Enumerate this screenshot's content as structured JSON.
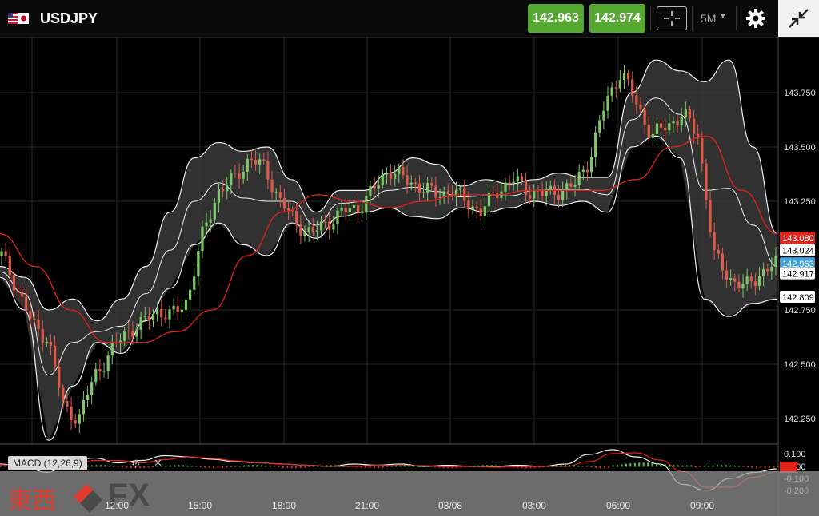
{
  "header": {
    "symbol": "USDJPY",
    "bid": "142.963",
    "ask": "142.974",
    "timeframe": "5M",
    "bid_color": "#56a832",
    "ask_color": "#56a832"
  },
  "macd": {
    "label": "MACD (12,26,9)",
    "ticks": [
      "0.100",
      "0.000",
      "-0.100",
      "-0.200"
    ]
  },
  "logo": {
    "text": "東西",
    "fx": "FX"
  },
  "chart_data": {
    "type": "candlestick",
    "symbol": "USDJPY",
    "timeframe": "5M",
    "y_ticks": [
      "143.750",
      "143.500",
      "143.250",
      "142.750",
      "142.500",
      "142.250"
    ],
    "ylim": [
      142.02,
      143.95
    ],
    "x_ticks": [
      "12:00",
      "15:00",
      "18:00",
      "21:00",
      "03/08",
      "03:00",
      "06:00",
      "09:00"
    ],
    "price_labels": [
      {
        "value": "143.080",
        "color": "#e0241c"
      },
      {
        "value": "143.024",
        "color": "#ffffff"
      },
      {
        "value": "142.963",
        "color": "#3fa0d8"
      },
      {
        "value": "142.917",
        "color": "#ffffff"
      },
      {
        "value": "142.809",
        "color": "#ffffff"
      }
    ],
    "close_path": [
      143.0,
      142.85,
      142.68,
      142.62,
      142.3,
      142.25,
      142.45,
      142.55,
      142.65,
      142.68,
      142.75,
      142.72,
      142.8,
      143.1,
      143.3,
      143.35,
      143.45,
      143.4,
      143.25,
      143.15,
      143.1,
      143.15,
      143.2,
      143.22,
      143.3,
      143.4,
      143.35,
      143.32,
      143.28,
      143.3,
      143.25,
      143.2,
      143.3,
      143.35,
      143.3,
      143.28,
      143.3,
      143.32,
      143.45,
      143.7,
      143.85,
      143.7,
      143.55,
      143.6,
      143.65,
      143.55,
      143.0,
      142.9,
      142.85,
      142.92,
      142.96
    ],
    "upper_band": [
      142.95,
      142.9,
      142.75,
      142.8,
      142.7,
      142.8,
      142.95,
      143.2,
      143.45,
      143.52,
      143.48,
      143.5,
      143.35,
      143.2,
      143.3,
      143.3,
      143.38,
      143.45,
      143.42,
      143.32,
      143.35,
      143.33,
      143.35,
      143.38,
      143.36,
      143.36,
      143.75,
      143.9,
      143.85,
      143.8,
      143.9,
      143.5,
      143.1
    ],
    "lower_band": [
      142.9,
      142.75,
      142.15,
      142.4,
      142.6,
      142.55,
      142.7,
      142.85,
      143.05,
      143.15,
      143.05,
      143.0,
      143.15,
      143.08,
      143.18,
      143.2,
      143.22,
      143.18,
      143.17,
      143.22,
      143.2,
      143.22,
      143.25,
      143.23,
      143.25,
      143.2,
      143.5,
      143.55,
      143.45,
      142.8,
      142.72,
      142.78,
      142.8
    ],
    "ma": [
      143.1,
      142.95,
      142.75,
      142.6,
      142.6,
      142.65,
      142.75,
      143.0,
      143.2,
      143.28,
      143.25,
      143.22,
      143.25,
      143.28,
      143.28,
      143.3,
      143.3,
      143.3,
      143.35,
      143.5,
      143.55,
      143.3,
      143.1
    ]
  }
}
